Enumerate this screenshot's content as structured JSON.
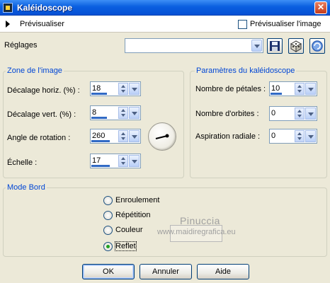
{
  "window": {
    "title": "Kaléidoscope",
    "close_glyph": "✕",
    "app_icon": "kaleidoscope-app-icon"
  },
  "preview": {
    "toggle_label": "Prévisualiser",
    "image_preview_label": "Prévisualiser l'image",
    "image_preview_checked": false
  },
  "settings": {
    "label": "Réglages",
    "preset_value": "",
    "buttons": [
      "save-preset-icon",
      "randomize-icon",
      "reset-icon"
    ]
  },
  "image_zone": {
    "title": "Zone de l'image",
    "fields": [
      {
        "label": "Décalage horiz. (%) :",
        "value": "18",
        "fill": 0.6
      },
      {
        "label": "Décalage vert. (%) :",
        "value": "8",
        "fill": 0.6
      },
      {
        "label": "Angle de rotation :",
        "value": "260",
        "fill": 0.72
      },
      {
        "label": "Échelle :",
        "value": "17",
        "fill": 0.72
      }
    ]
  },
  "kaleido_params": {
    "title": "Paramètres du kaléidoscope",
    "fields": [
      {
        "label": "Nombre de pétales :",
        "value": "10",
        "fill": 0.5
      },
      {
        "label": "Nombre d'orbites :",
        "value": "0",
        "fill": 0
      },
      {
        "label": "Aspiration radiale :",
        "value": "0",
        "fill": 0
      }
    ]
  },
  "border_mode": {
    "title": "Mode Bord",
    "options": [
      "Enroulement",
      "Répétition",
      "Couleur",
      "Reflet"
    ],
    "selected": "Reflet"
  },
  "watermark": {
    "name": "Pinuccia",
    "url": "www.maidiregrafica.eu"
  },
  "buttons": {
    "ok": "OK",
    "cancel": "Annuler",
    "help": "Aide"
  },
  "colors": {
    "title_bar": "#0a5fe0",
    "group_title": "#0046d5",
    "value_bar": "#316ac5",
    "radio_selected": "#21a121"
  }
}
